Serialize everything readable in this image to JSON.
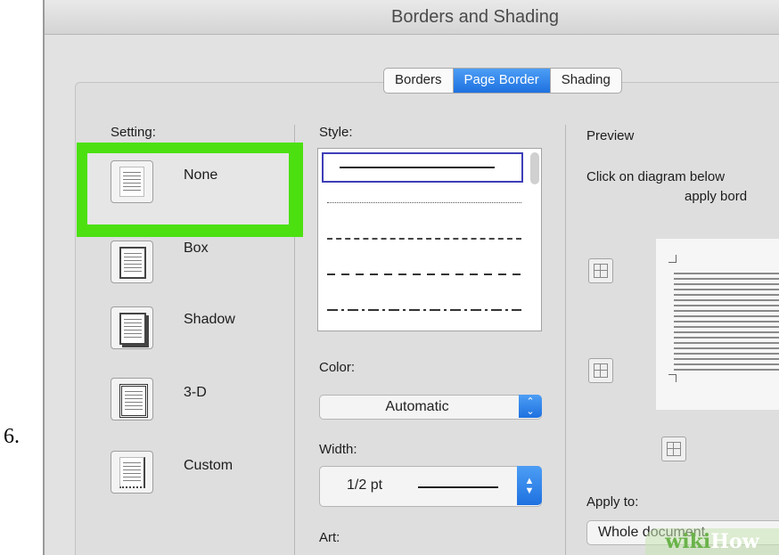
{
  "step_number": "6.",
  "window": {
    "title": "Borders and Shading"
  },
  "tabs": [
    {
      "label": "Borders",
      "active": false
    },
    {
      "label": "Page Border",
      "active": true
    },
    {
      "label": "Shading",
      "active": false
    }
  ],
  "setting": {
    "label": "Setting:",
    "options": [
      {
        "label": "None",
        "selected": true
      },
      {
        "label": "Box"
      },
      {
        "label": "Shadow"
      },
      {
        "label": "3-D"
      },
      {
        "label": "Custom"
      }
    ]
  },
  "style": {
    "label": "Style:",
    "items": [
      "solid",
      "dotted",
      "dashed-small",
      "dashed",
      "dash-dot"
    ]
  },
  "color": {
    "label": "Color:",
    "value": "Automatic"
  },
  "width": {
    "label": "Width:",
    "value": "1/2 pt"
  },
  "art": {
    "label": "Art:"
  },
  "preview": {
    "label": "Preview",
    "instruction_line1": "Click on diagram below",
    "instruction_line2": "apply bord"
  },
  "apply_to": {
    "label": "Apply to:",
    "value": "Whole document"
  },
  "watermark": {
    "text_wiki": "wiki",
    "text_how": "How"
  },
  "colors": {
    "highlight": "#4ce010",
    "accent": "#1e71e0"
  }
}
